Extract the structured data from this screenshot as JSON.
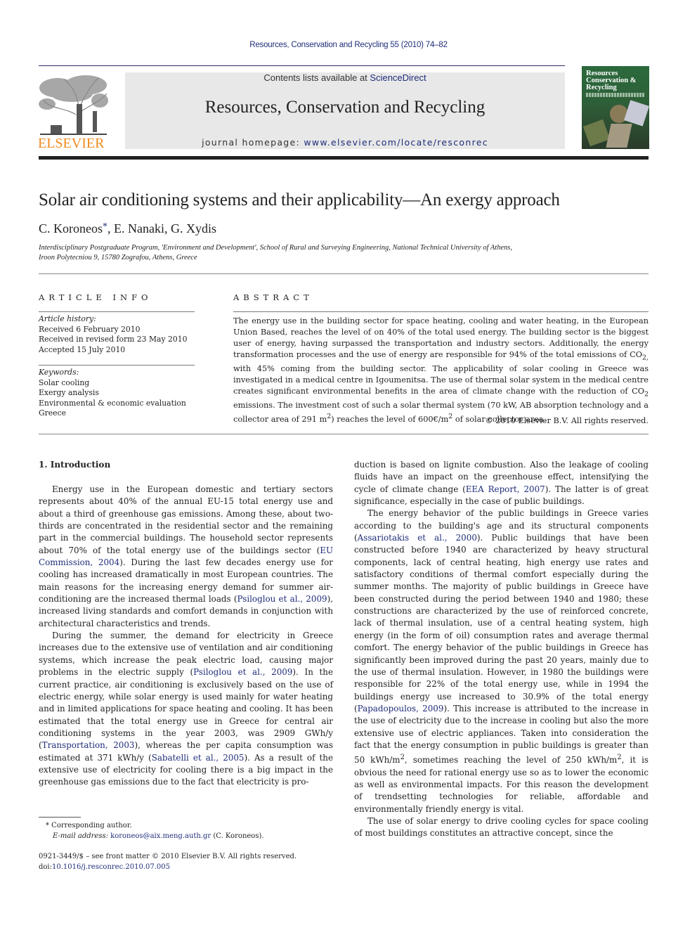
{
  "header": {
    "citation": "Resources, Conservation and Recycling 55 (2010) 74–82",
    "contents_prefix": "Contents lists available at ",
    "contents_link": "ScienceDirect",
    "journal_title": "Resources, Conservation and Recycling",
    "homepage_prefix": "journal homepage: ",
    "homepage_link": "www.elsevier.com/locate/resconrec",
    "publisher_logo": "ELSEVIER",
    "cover_title_lines": [
      "Resources",
      "Conservation &",
      "Recycling"
    ],
    "icons": {
      "publisher": "elsevier-tree-logo",
      "cover": "journal-cover-thumbnail"
    },
    "colors": {
      "link": "#1f2d7a",
      "elsevier_orange": "#f08a1e",
      "banner_bg": "#e8e8e8",
      "cover_green": "#2b6a3c"
    }
  },
  "article": {
    "title": "Solar air conditioning systems and their applicability—An exergy approach",
    "authors": [
      {
        "name": "C. Koroneos",
        "marker": "*"
      },
      {
        "name": "E. Nanaki"
      },
      {
        "name": "G. Xydis"
      }
    ],
    "author_sep": ", ",
    "affiliation_line1": "Interdisciplinary Postgraduate Program, 'Environment and Development', School of Rural and Surveying Engineering, National Technical University of Athens,",
    "affiliation_line2": "Iroon Polytecniou 9, 15780 Zografou, Athens, Greece"
  },
  "article_info": {
    "heading": "ARTICLE INFO",
    "history_label": "Article history:",
    "history": [
      "Received 6 February 2010",
      "Received in revised form 23 May 2010",
      "Accepted 15 July 2010"
    ],
    "keywords_label": "Keywords:",
    "keywords": [
      "Solar cooling",
      "Exergy analysis",
      "Environmental & economic evaluation",
      "Greece"
    ]
  },
  "abstract": {
    "heading": "ABSTRACT",
    "p1": "The energy use in the building sector for space heating, cooling and water heating, in the European Union Based, reaches the level of on 40% of the total used energy. The building sector is the biggest user of energy, having surpassed the transportation and industry sectors. Additionally, the energy transformation processes and the use of energy are responsible for 94% of the total emissions of CO",
    "p2": " with 45% coming from the building sector. The applicability of solar cooling in Greece was investigated in a medical centre in Igoumenitsa. The use of thermal solar system in the medical centre creates significant environmental benefits in the area of climate change with the reduction of CO",
    "p3": " emissions. The investment cost of such a solar thermal system (70 kW, AB absorption technology and a collector area of 291 m",
    "p4": ") reaches the level of 600€/m",
    "p5": " of solar collector area.",
    "sub2": "2",
    "sub2b": "2,",
    "sup2": "2",
    "copyright": "© 2010 Elsevier B.V. All rights reserved."
  },
  "intro": {
    "heading": "1.  Introduction",
    "para1": {
      "t1": "Energy use in the European domestic and tertiary sectors represents about 40% of the annual EU-15 total energy use and about a third of greenhouse gas emissions. Among these, about two-thirds are concentrated in the residential sector and the remaining part in the commercial buildings. The household sector represents about 70% of the total energy use of the buildings sector (",
      "ref1": "EU Commission, 2004",
      "t2": "). During the last few decades energy use for cooling has increased dramatically in most European countries. The main reasons for the increasing energy demand for summer air-conditioning are the increased thermal loads (",
      "ref2": "Psiloglou et al., 2009",
      "t3": "), increased living standards and comfort demands in conjunction with architectural characteristics and trends."
    },
    "para2": {
      "t1": "During the summer, the demand for electricity in Greece increases due to the extensive use of ventilation and air conditioning systems, which increase the peak electric load, causing major problems in the electric supply (",
      "ref1": "Psiloglou et al., 2009",
      "t2": "). In the current practice, air conditioning is exclusively based on the use of electric energy, while solar energy is used mainly for water heating and in limited applications for space heating and cooling. It has been estimated that the total energy use in Greece for central air conditioning systems in the year 2003, was 2909 GWh/y (",
      "ref2": "Transportation, 2003",
      "t3": "), whereas the per capita consumption was estimated at 371 kWh/y (",
      "ref3": "Sabatelli et al., 2005",
      "t4": "). As a result of the extensive use of electricity for cooling there is a big impact in the greenhouse gas emissions due to the fact that electricity is pro-"
    },
    "para2_cont": {
      "t1": "duction is based on lignite combustion. Also the leakage of cooling fluids have an impact on the greenhouse effect, intensifying the cycle of climate change (",
      "ref1": "EEA Report, 2007",
      "t2": "). The latter is of great significance, especially in the case of public buildings."
    },
    "para3": {
      "t1": "The energy behavior of the public buildings in Greece varies according to the building's age and its structural components (",
      "ref1": "Assariotakis et al., 2000",
      "t2": "). Public buildings that have been constructed before 1940 are characterized by heavy structural components, lack of central heating, high energy use rates and satisfactory conditions of thermal comfort especially during the summer months. The majority of public buildings in Greece have been constructed during the period between 1940 and 1980; these constructions are characterized by the use of reinforced concrete, lack of thermal insulation, use of a central heating system, high energy (in the form of oil) consumption rates and average thermal comfort. The energy behavior of the public buildings in Greece has significantly been improved during the past 20 years, mainly due to the use of thermal insulation. However, in 1980 the buildings were responsible for 22% of the total energy use, while in 1994 the buildings energy use increased to 30.9% of the total energy (",
      "ref2": "Papadopoulos, 2009",
      "t3": "). This increase is attributed to the increase in the use of electricity due to the increase in cooling but also the more extensive use of electric appliances. Taken into consideration the fact that the energy consumption in public buildings is greater than 50 kWh/m",
      "sup": "2",
      "t4": ", sometimes reaching the level of 250 kWh/m",
      "t5": ", it is obvious the need for rational energy use so as to lower the economic as well as environmental impacts. For this reason the development of trendsetting technologies for reliable, affordable and environmentally friendly energy is vital."
    },
    "para4": {
      "t1": "The use of solar energy to drive cooling cycles for space cooling of most buildings constitutes an attractive concept, since the"
    }
  },
  "footnote": {
    "marker": "*",
    "corresponding": " Corresponding author.",
    "email_label": "E-mail address:",
    "email": "koroneos@aix.meng.auth.gr",
    "email_suffix": " (C. Koroneos).",
    "issn": "0921-3449/$ – see front matter © 2010 Elsevier B.V. All rights reserved.",
    "doi_prefix": "doi:",
    "doi": "10.1016/j.resconrec.2010.07.005"
  }
}
